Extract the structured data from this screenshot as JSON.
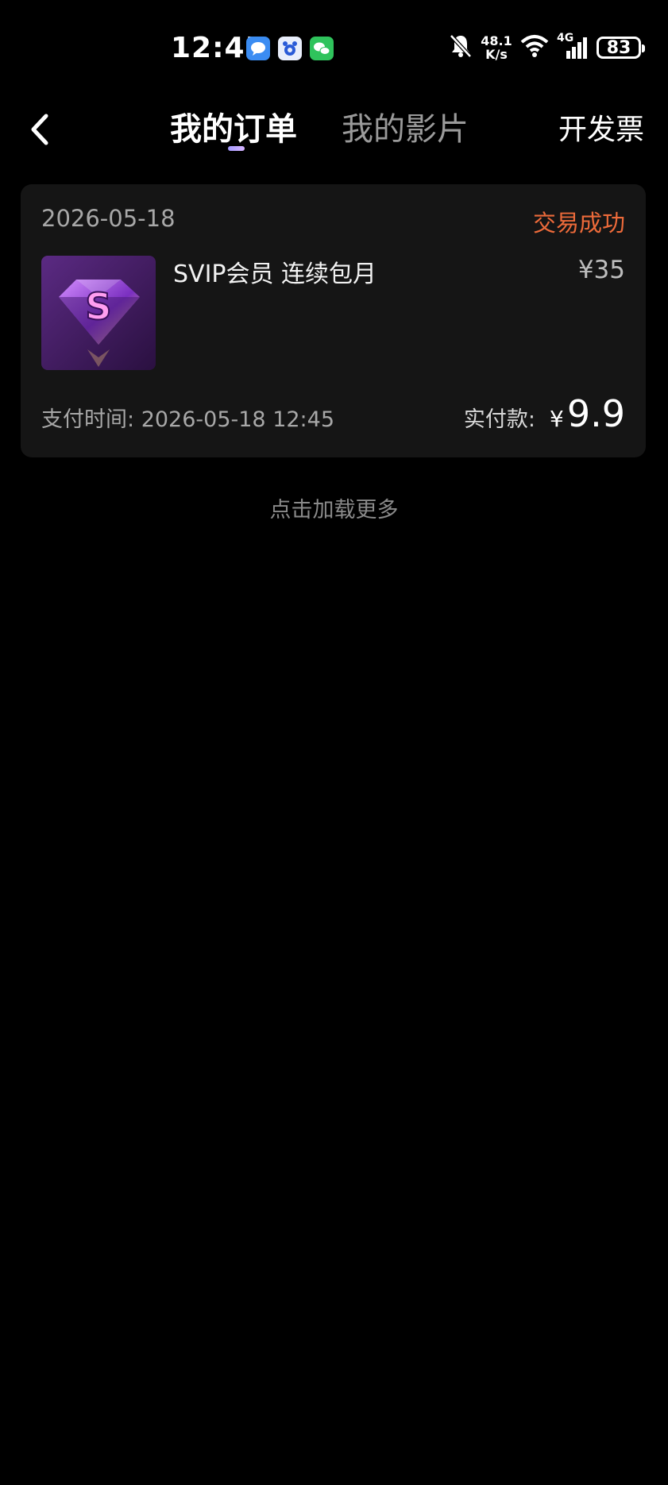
{
  "status_bar": {
    "time": "12:45",
    "net_speed_value": "48.1",
    "net_speed_unit": "K/s",
    "network_type": "4G",
    "battery": "83",
    "icons": [
      "message-app-icon",
      "baidu-app-icon",
      "wechat-app-icon",
      "mute-bell-icon",
      "wifi-icon",
      "signal-icon",
      "battery-icon"
    ]
  },
  "header": {
    "tabs": [
      {
        "label": "我的订单",
        "active": true
      },
      {
        "label": "我的影片",
        "active": false
      }
    ],
    "invoice_label": "开发票"
  },
  "orders": [
    {
      "date": "2026-05-18",
      "status": "交易成功",
      "product_name": "SVIP会员 连续包月",
      "original_price": "¥35",
      "pay_time_label": "支付时间:",
      "pay_time": "2026-05-18 12:45",
      "paid_label": "实付款:",
      "currency": "¥",
      "paid_amount": "9.9"
    }
  ],
  "load_more": "点击加载更多",
  "colors": {
    "background": "#000000",
    "card": "#151515",
    "status_success": "#ec6a3a",
    "secondary_text": "#a8a8a8"
  }
}
